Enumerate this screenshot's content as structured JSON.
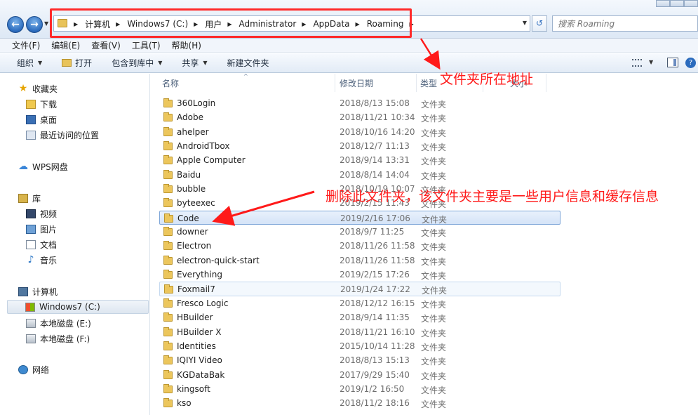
{
  "address_bar": {
    "crumbs": [
      "计算机",
      "Windows7 (C:)",
      "用户",
      "Administrator",
      "AppData",
      "Roaming"
    ],
    "search_placeholder": "搜索 Roaming"
  },
  "menu": [
    "文件(F)",
    "编辑(E)",
    "查看(V)",
    "工具(T)",
    "帮助(H)"
  ],
  "toolbar": {
    "organize": "组织",
    "open": "打开",
    "include_library": "包含到库中",
    "share": "共享",
    "new_folder": "新建文件夹"
  },
  "sidebar": {
    "favorites": "收藏夹",
    "downloads": "下载",
    "desktop": "桌面",
    "recent": "最近访问的位置",
    "wps": "WPS网盘",
    "libraries": "库",
    "videos": "视频",
    "pictures": "图片",
    "documents": "文档",
    "music": "音乐",
    "computer": "计算机",
    "drive_c": "Windows7 (C:)",
    "drive_e": "本地磁盘 (E:)",
    "drive_f": "本地磁盘 (F:)",
    "network": "网络"
  },
  "columns": {
    "name": "名称",
    "date": "修改日期",
    "type": "类型",
    "size": "大小"
  },
  "files": [
    {
      "name": "360Login",
      "date": "2018/8/13 15:08",
      "type": "文件夹"
    },
    {
      "name": "Adobe",
      "date": "2018/11/21 10:34",
      "type": "文件夹"
    },
    {
      "name": "ahelper",
      "date": "2018/10/16 14:20",
      "type": "文件夹"
    },
    {
      "name": "AndroidTbox",
      "date": "2018/12/7 11:13",
      "type": "文件夹"
    },
    {
      "name": "Apple Computer",
      "date": "2018/9/14 13:31",
      "type": "文件夹"
    },
    {
      "name": "Baidu",
      "date": "2018/8/14 14:04",
      "type": "文件夹"
    },
    {
      "name": "bubble",
      "date": "2018/10/19 10:07",
      "type": "文件夹"
    },
    {
      "name": "byteexec",
      "date": "2019/2/15 11:43",
      "type": "文件夹"
    },
    {
      "name": "Code",
      "date": "2019/2/16 17:06",
      "type": "文件夹"
    },
    {
      "name": "downer",
      "date": "2018/9/7 11:25",
      "type": "文件夹"
    },
    {
      "name": "Electron",
      "date": "2018/11/26 11:58",
      "type": "文件夹"
    },
    {
      "name": "electron-quick-start",
      "date": "2018/11/26 11:58",
      "type": "文件夹"
    },
    {
      "name": "Everything",
      "date": "2019/2/15 17:26",
      "type": "文件夹"
    },
    {
      "name": "Foxmail7",
      "date": "2019/1/24 17:22",
      "type": "文件夹"
    },
    {
      "name": "Fresco Logic",
      "date": "2018/12/12 16:15",
      "type": "文件夹"
    },
    {
      "name": "HBuilder",
      "date": "2018/9/14 11:35",
      "type": "文件夹"
    },
    {
      "name": "HBuilder X",
      "date": "2018/11/21 16:10",
      "type": "文件夹"
    },
    {
      "name": "Identities",
      "date": "2015/10/14 11:28",
      "type": "文件夹"
    },
    {
      "name": "IQIYI Video",
      "date": "2018/8/13 15:13",
      "type": "文件夹"
    },
    {
      "name": "KGDataBak",
      "date": "2017/9/29 15:40",
      "type": "文件夹"
    },
    {
      "name": "kingsoft",
      "date": "2019/1/2 16:50",
      "type": "文件夹"
    },
    {
      "name": "kso",
      "date": "2018/11/2 18:16",
      "type": "文件夹"
    }
  ],
  "annotations": {
    "address": "文件夹所在地址",
    "delete": "删除此文件夹，该文件夹主要是一些用户信息和缓存信息"
  },
  "colors": {
    "annotation_red": "#ff1a1a",
    "selection_border": "#7ea6d8"
  }
}
